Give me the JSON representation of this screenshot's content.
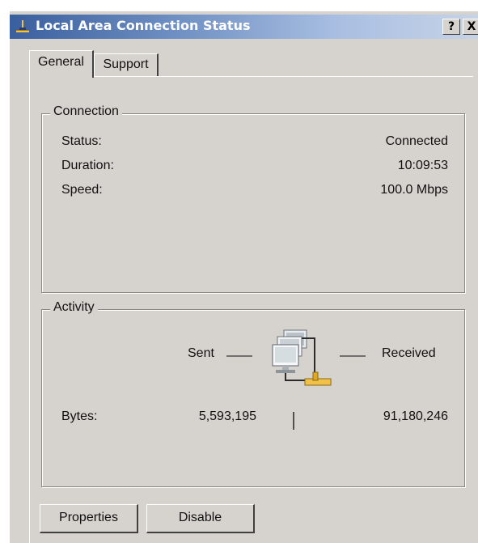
{
  "window": {
    "title": "Local Area Connection Status",
    "help_label": "?",
    "close_label": "X"
  },
  "tabs": [
    {
      "label": "General",
      "active": true
    },
    {
      "label": "Support",
      "active": false
    }
  ],
  "connection": {
    "group_label": "Connection",
    "rows": [
      {
        "label": "Status:",
        "value": "Connected"
      },
      {
        "label": "Duration:",
        "value": "10:09:53"
      },
      {
        "label": "Speed:",
        "value": "100.0 Mbps"
      }
    ]
  },
  "activity": {
    "group_label": "Activity",
    "sent_label": "Sent",
    "received_label": "Received",
    "bytes_label": "Bytes:",
    "bytes_sent": "5,593,195",
    "bytes_received": "91,180,246",
    "icon": "network-computers-icon"
  },
  "buttons": {
    "properties": "Properties",
    "disable": "Disable"
  }
}
